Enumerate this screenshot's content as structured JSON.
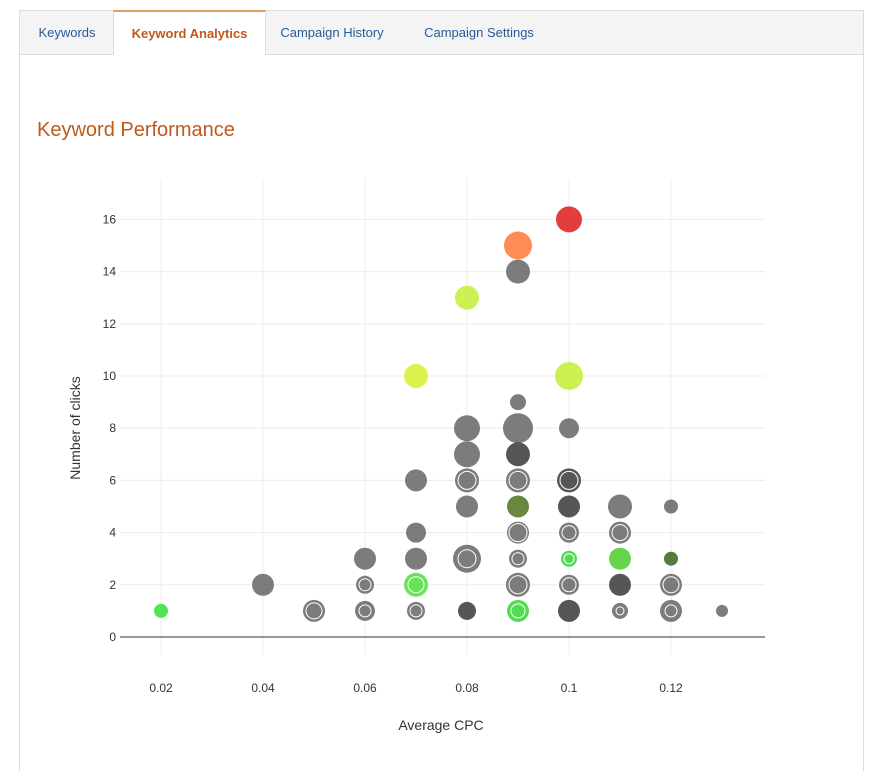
{
  "tabs": [
    {
      "label": "Keywords",
      "active": false
    },
    {
      "label": "Keyword Analytics",
      "active": true
    },
    {
      "label": "Campaign History",
      "active": false
    },
    {
      "label": "Campaign Settings",
      "active": false
    }
  ],
  "section": {
    "title": "Keyword Performance"
  },
  "colors": {
    "accent": "#c0591a",
    "tab_link": "#2a5a96",
    "grey": "#6e6e6e",
    "dark": "#444444"
  },
  "chart_data": {
    "type": "scatter",
    "xlabel": "Average CPC",
    "ylabel": "Number of clicks",
    "xlim": [
      0.01,
      0.135
    ],
    "ylim": [
      -0.6,
      17.5
    ],
    "xticks": [
      "0.02",
      "0.04",
      "0.06",
      "0.08",
      "0.1",
      "0.12"
    ],
    "xtick_values": [
      0.02,
      0.04,
      0.06,
      0.08,
      0.1,
      0.12
    ],
    "yticks": [
      "0",
      "2",
      "4",
      "6",
      "8",
      "10",
      "12",
      "14",
      "16"
    ],
    "ytick_values": [
      0,
      2,
      4,
      6,
      8,
      10,
      12,
      14,
      16
    ],
    "grid": true,
    "points": [
      {
        "x": 0.02,
        "y": 1,
        "size": 7,
        "color": "#3fe03f"
      },
      {
        "x": 0.04,
        "y": 2,
        "size": 11,
        "color": "#6e6e6e"
      },
      {
        "x": 0.05,
        "y": 1,
        "size": 11,
        "color": "#6e6e6e",
        "inner": 8
      },
      {
        "x": 0.06,
        "y": 3,
        "size": 11,
        "color": "#6e6e6e"
      },
      {
        "x": 0.06,
        "y": 2,
        "size": 9,
        "color": "#6e6e6e",
        "inner": 6
      },
      {
        "x": 0.06,
        "y": 1,
        "size": 10,
        "color": "#6e6e6e",
        "inner": 6
      },
      {
        "x": 0.07,
        "y": 10,
        "size": 12,
        "color": "#d8f03a"
      },
      {
        "x": 0.07,
        "y": 6,
        "size": 11,
        "color": "#6e6e6e"
      },
      {
        "x": 0.07,
        "y": 4,
        "size": 10,
        "color": "#6e6e6e"
      },
      {
        "x": 0.07,
        "y": 3,
        "size": 11,
        "color": "#6e6e6e"
      },
      {
        "x": 0.07,
        "y": 2,
        "size": 12,
        "color": "#55e045",
        "inner": 8
      },
      {
        "x": 0.07,
        "y": 1,
        "size": 9,
        "color": "#6e6e6e",
        "inner": 6
      },
      {
        "x": 0.08,
        "y": 13,
        "size": 12,
        "color": "#c8f040"
      },
      {
        "x": 0.08,
        "y": 8,
        "size": 13,
        "color": "#6e6e6e"
      },
      {
        "x": 0.08,
        "y": 7,
        "size": 13,
        "color": "#6e6e6e"
      },
      {
        "x": 0.08,
        "y": 6,
        "size": 12,
        "color": "#6e6e6e",
        "inner": 9
      },
      {
        "x": 0.08,
        "y": 5,
        "size": 11,
        "color": "#6e6e6e"
      },
      {
        "x": 0.08,
        "y": 3,
        "size": 14,
        "color": "#6e6e6e",
        "inner": 9
      },
      {
        "x": 0.08,
        "y": 1,
        "size": 9,
        "color": "#444444"
      },
      {
        "x": 0.09,
        "y": 15,
        "size": 14,
        "color": "#ff8040"
      },
      {
        "x": 0.09,
        "y": 14,
        "size": 12,
        "color": "#6e6e6e"
      },
      {
        "x": 0.09,
        "y": 9,
        "size": 8,
        "color": "#6e6e6e"
      },
      {
        "x": 0.09,
        "y": 8,
        "size": 15,
        "color": "#6e6e6e"
      },
      {
        "x": 0.09,
        "y": 7,
        "size": 12,
        "color": "#444444"
      },
      {
        "x": 0.09,
        "y": 6,
        "size": 12,
        "color": "#6e6e6e",
        "inner": 9
      },
      {
        "x": 0.09,
        "y": 5,
        "size": 11,
        "color": "#5a7a2a"
      },
      {
        "x": 0.09,
        "y": 4,
        "size": 11,
        "color": "#6e6e6e",
        "inner": 9
      },
      {
        "x": 0.09,
        "y": 3,
        "size": 9,
        "color": "#6e6e6e",
        "inner": 6
      },
      {
        "x": 0.09,
        "y": 2,
        "size": 12,
        "color": "#6e6e6e",
        "inner": 9
      },
      {
        "x": 0.09,
        "y": 1,
        "size": 11,
        "color": "#3fd83f",
        "inner": 7
      },
      {
        "x": 0.1,
        "y": 16,
        "size": 13,
        "color": "#e02828"
      },
      {
        "x": 0.1,
        "y": 10,
        "size": 14,
        "color": "#c8f040"
      },
      {
        "x": 0.1,
        "y": 8,
        "size": 10,
        "color": "#6e6e6e"
      },
      {
        "x": 0.1,
        "y": 6,
        "size": 12,
        "color": "#444444",
        "inner": 9
      },
      {
        "x": 0.1,
        "y": 5,
        "size": 11,
        "color": "#444444"
      },
      {
        "x": 0.1,
        "y": 4,
        "size": 10,
        "color": "#6e6e6e",
        "inner": 7
      },
      {
        "x": 0.1,
        "y": 3,
        "size": 8,
        "color": "#3fd83f",
        "inner": 5
      },
      {
        "x": 0.1,
        "y": 2,
        "size": 10,
        "color": "#6e6e6e",
        "inner": 7
      },
      {
        "x": 0.1,
        "y": 1,
        "size": 11,
        "color": "#444444"
      },
      {
        "x": 0.11,
        "y": 5,
        "size": 12,
        "color": "#6e6e6e"
      },
      {
        "x": 0.11,
        "y": 4,
        "size": 11,
        "color": "#6e6e6e",
        "inner": 8
      },
      {
        "x": 0.11,
        "y": 3,
        "size": 11,
        "color": "#55d035"
      },
      {
        "x": 0.11,
        "y": 2,
        "size": 11,
        "color": "#444444"
      },
      {
        "x": 0.11,
        "y": 1,
        "size": 8,
        "color": "#6e6e6e",
        "inner": 4
      },
      {
        "x": 0.12,
        "y": 5,
        "size": 7,
        "color": "#6e6e6e"
      },
      {
        "x": 0.12,
        "y": 3,
        "size": 7,
        "color": "#4a6a2a"
      },
      {
        "x": 0.12,
        "y": 2,
        "size": 11,
        "color": "#6e6e6e",
        "inner": 8
      },
      {
        "x": 0.12,
        "y": 1,
        "size": 11,
        "color": "#6e6e6e",
        "inner": 6
      },
      {
        "x": 0.13,
        "y": 1,
        "size": 6,
        "color": "#6e6e6e"
      }
    ]
  }
}
